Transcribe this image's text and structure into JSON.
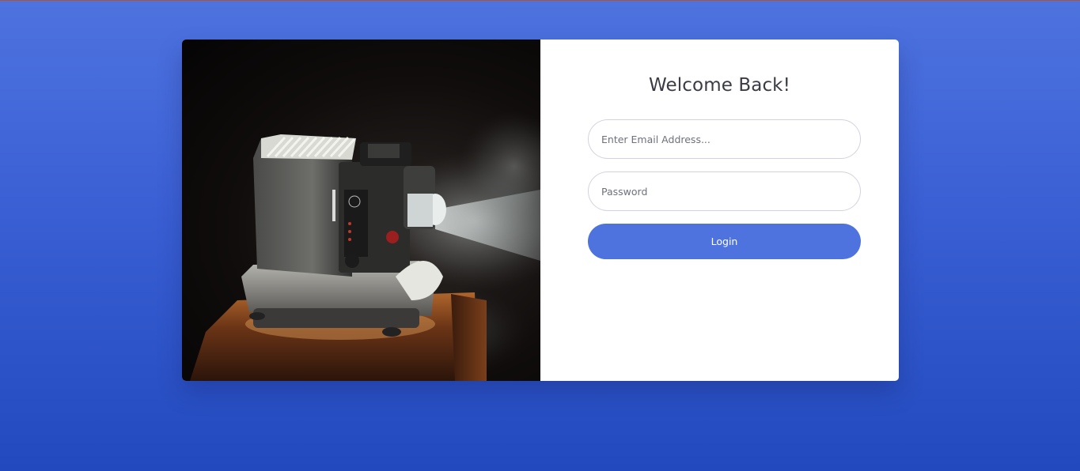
{
  "login": {
    "title": "Welcome Back!",
    "email_placeholder": "Enter Email Address...",
    "password_placeholder": "Password",
    "submit_label": "Login"
  },
  "colors": {
    "background_top": "#4e73df",
    "background_bottom": "#224abe",
    "button": "#4e73df",
    "title_text": "#3a3b45"
  },
  "image": {
    "subject": "vintage film projector on wooden box emitting light beam"
  }
}
